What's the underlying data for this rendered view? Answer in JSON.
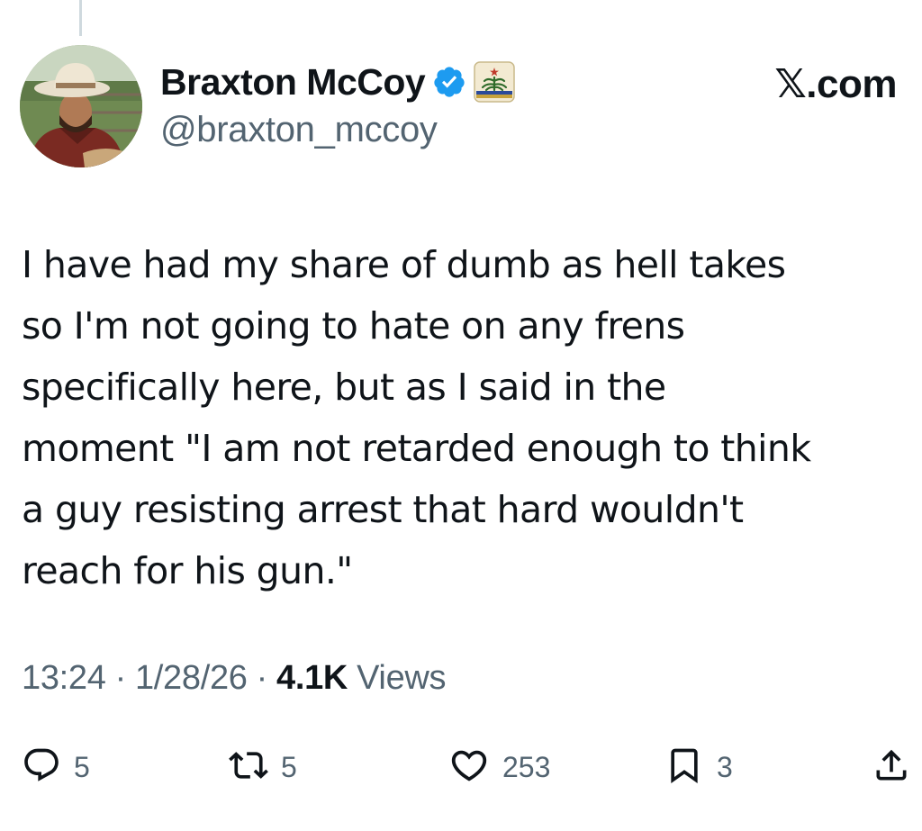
{
  "tweet": {
    "display_name": "Braxton McCoy",
    "handle": "@braxton_mccoy",
    "source": "𝕏.com",
    "text": "I have had my share of dumb as hell takes\nso I'm not going to hate on any frens\nspecifically here, but as I said in the\nmoment \"I am not retarded enough to think\na guy resisting arrest that hard wouldn't\nreach for his gun.\"",
    "time": "13:24",
    "date": "1/28/26",
    "separator": "·",
    "views_count": "4.1K",
    "views_label": "Views"
  },
  "actions": {
    "replies": "5",
    "reposts": "5",
    "likes": "253",
    "bookmarks": "3"
  },
  "icons": {
    "verified": "verified-badge-icon",
    "affiliate": "affiliate-flag-icon",
    "reply": "reply-icon",
    "repost": "repost-icon",
    "like": "heart-icon",
    "bookmark": "bookmark-icon",
    "share": "share-icon"
  },
  "colors": {
    "text_primary": "#0f1419",
    "text_secondary": "#536471",
    "verified_blue": "#1d9bf0"
  }
}
